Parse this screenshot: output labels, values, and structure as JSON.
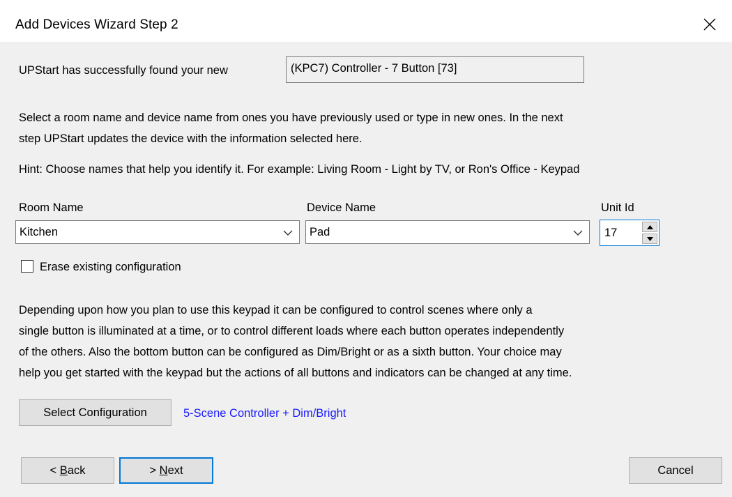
{
  "window": {
    "title": "Add Devices Wizard Step 2"
  },
  "found": {
    "label": "UPStart has successfully found your new",
    "device": "(KPC7) Controller - 7 Button [73]"
  },
  "instructions": {
    "line1": "Select a room name and device name from ones you have previously used or type in new ones.  In the next",
    "line2": "step UPStart updates the device with the information selected here.",
    "hint": "Hint: Choose names that help you identify it.  For example: Living Room - Light by TV, or Ron's Office - Keypad"
  },
  "room": {
    "label": "Room Name",
    "value": "Kitchen"
  },
  "device": {
    "label": "Device Name",
    "value": "Pad"
  },
  "unit": {
    "label": "Unit Id",
    "value": "17"
  },
  "erase": {
    "label": "Erase existing configuration",
    "checked": false
  },
  "description": {
    "line1": "Depending upon how you plan to use this keypad it can be configured to control scenes where only a",
    "line2": "single button is illuminated at a time, or to control different loads where each button operates independently",
    "line3": "of the others. Also the bottom button can be configured as Dim/Bright or as a sixth button. Your choice may",
    "line4": "help you get started with the keypad but the actions of all buttons and indicators can be changed at any time."
  },
  "config": {
    "button_label": "Select Configuration",
    "current": "5-Scene Controller + Dim/Bright"
  },
  "nav": {
    "back_prefix": "< ",
    "back_mnemonic": "B",
    "back_rest": "ack",
    "next_prefix": "> ",
    "next_mnemonic": "N",
    "next_rest": "ext",
    "cancel": "Cancel"
  },
  "colors": {
    "link": "#1a1aff",
    "focus": "#0078d7",
    "panel": "#f0f0f0"
  }
}
